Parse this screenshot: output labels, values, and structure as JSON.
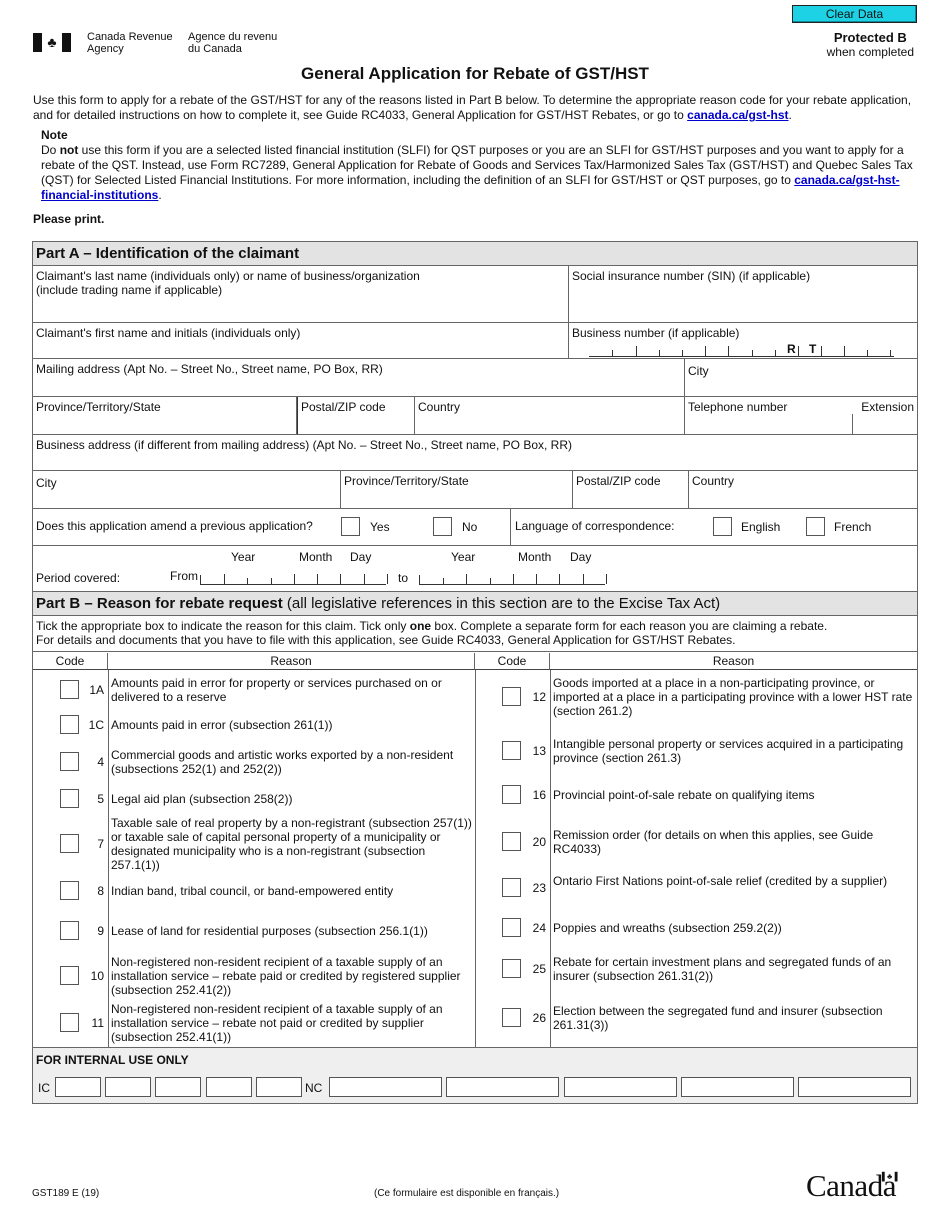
{
  "header": {
    "agency_en_line1": "Canada Revenue",
    "agency_en_line2": "Agency",
    "agency_fr_line1": "Agence du revenu",
    "agency_fr_line2": "du Canada",
    "clear_button": "Clear Data",
    "protected_title": "Protected B",
    "protected_sub": "when completed",
    "icons": {
      "flag": "canada-flag-icon",
      "leaf": "maple-leaf-icon"
    }
  },
  "title": "General Application for Rebate of GST/HST",
  "intro": {
    "text": "Use this form to apply for a rebate of the GST/HST for any of the reasons listed in Part B below. To determine the appropriate reason code for your rebate application, and for detailed instructions on how to complete it, see Guide RC4033, General Application for GST/HST Rebates, or go to ",
    "link": "canada.ca/gst-hst",
    "end": "."
  },
  "note": {
    "heading": "Note",
    "pre": "Do ",
    "bold": "not",
    "text": " use this form if you are a selected listed financial institution (SLFI) for QST purposes or you are an SLFI for GST/HST purposes and you want to apply for a rebate of the QST. Instead, use Form RC7289, General Application for Rebate of Goods and Services Tax/Harmonized Sales Tax (GST/HST) and Quebec Sales Tax (QST) for Selected Listed Financial Institutions. For more information, including the definition of an SLFI for GST/HST or QST purposes, go to ",
    "link": "canada.ca/gst-hst-financial-institutions",
    "end": "."
  },
  "please_print": "Please print.",
  "part_a": {
    "heading": "Part A – Identification of the claimant",
    "last_name_l1": "Claimant's last name (individuals only) or name of business/organization",
    "last_name_l2": "(include trading name if applicable)",
    "sin": "Social insurance number (SIN) (if applicable)",
    "first_name": "Claimant's first name and initials (individuals only)",
    "business_number": "Business number (if applicable)",
    "bn_r": "R",
    "bn_t": "T",
    "mailing_address": "Mailing address (Apt No. – Street No., Street name, PO Box, RR)",
    "city": "City",
    "province": "Province/Territory/State",
    "postal": "Postal/ZIP code",
    "country": "Country",
    "telephone": "Telephone number",
    "extension": "Extension",
    "business_address": "Business address (if different from mailing address)  (Apt No. – Street No., Street name, PO Box, RR)",
    "b_city": "City",
    "b_province": "Province/Territory/State",
    "b_postal": "Postal/ZIP code",
    "b_country": "Country",
    "amend_question": "Does this application amend a previous application?",
    "yes": "Yes",
    "no": "No",
    "language_label": "Language of correspondence:",
    "english": "English",
    "french": "French",
    "period_label": "Period covered:",
    "from": "From",
    "to": "to",
    "year": "Year",
    "month": "Month",
    "day": "Day"
  },
  "part_b": {
    "heading_bold": "Part B – Reason for rebate request",
    "heading_rest": " (all legislative references in this section are to the Excise Tax Act)",
    "instr1_pre": "Tick the appropriate box to indicate the reason for this claim. Tick only ",
    "instr1_bold": "one",
    "instr1_post": " box. Complete a separate form for each reason you are claiming a rebate.",
    "instr2": "For details and documents that you have to file with this application, see Guide RC4033, General Application for GST/HST Rebates.",
    "col_code": "Code",
    "col_reason": "Reason",
    "left": [
      {
        "code": "1A",
        "reason": "Amounts paid in error for property or services purchased on or delivered to a reserve"
      },
      {
        "code": "1C",
        "reason": "Amounts paid in error (subsection 261(1))"
      },
      {
        "code": "4",
        "reason": "Commercial goods and artistic works exported by a non-resident (subsections 252(1) and 252(2))"
      },
      {
        "code": "5",
        "reason": "Legal aid plan (subsection 258(2))"
      },
      {
        "code": "7",
        "reason": "Taxable sale of real property by a non-registrant (subsection 257(1)) or taxable sale of capital personal property of a municipality or designated municipality who is a non-registrant (subsection 257.1(1))"
      },
      {
        "code": "8",
        "reason": "Indian band, tribal council, or band-empowered entity"
      },
      {
        "code": "9",
        "reason": "Lease of land for residential purposes (subsection 256.1(1))"
      },
      {
        "code": "10",
        "reason": "Non-registered non-resident recipient of a taxable supply of an installation service – rebate paid or credited by registered supplier (subsection 252.41(2))"
      },
      {
        "code": "11",
        "reason": "Non-registered non-resident recipient of a taxable supply of an installation service – rebate not paid or credited by supplier (subsection 252.41(1))"
      }
    ],
    "right": [
      {
        "code": "12",
        "reason": "Goods imported at a place in a non-participating province, or imported at a place in a participating province with a lower HST rate (section 261.2)"
      },
      {
        "code": "13",
        "reason": "Intangible personal property or services acquired in a participating province (section 261.3)"
      },
      {
        "code": "16",
        "reason": "Provincial point-of-sale rebate on qualifying items"
      },
      {
        "code": "20",
        "reason": "Remission order (for details on when this applies, see Guide RC4033)"
      },
      {
        "code": "23",
        "reason": "Ontario First Nations point-of-sale relief (credited by a supplier)"
      },
      {
        "code": "24",
        "reason": "Poppies and wreaths (subsection 259.2(2))"
      },
      {
        "code": "25",
        "reason": "Rebate for certain investment plans and segregated funds of an insurer (subsection 261.31(2))"
      },
      {
        "code": "26",
        "reason": "Election between the segregated fund and insurer (subsection 261.31(3))"
      }
    ]
  },
  "internal": {
    "heading": "FOR INTERNAL USE ONLY",
    "ic": "IC",
    "nc": "NC"
  },
  "footer": {
    "form_id": "GST189 E (19)",
    "french_note": "(Ce formulaire est disponible en français.)",
    "wordmark": "Canada"
  }
}
